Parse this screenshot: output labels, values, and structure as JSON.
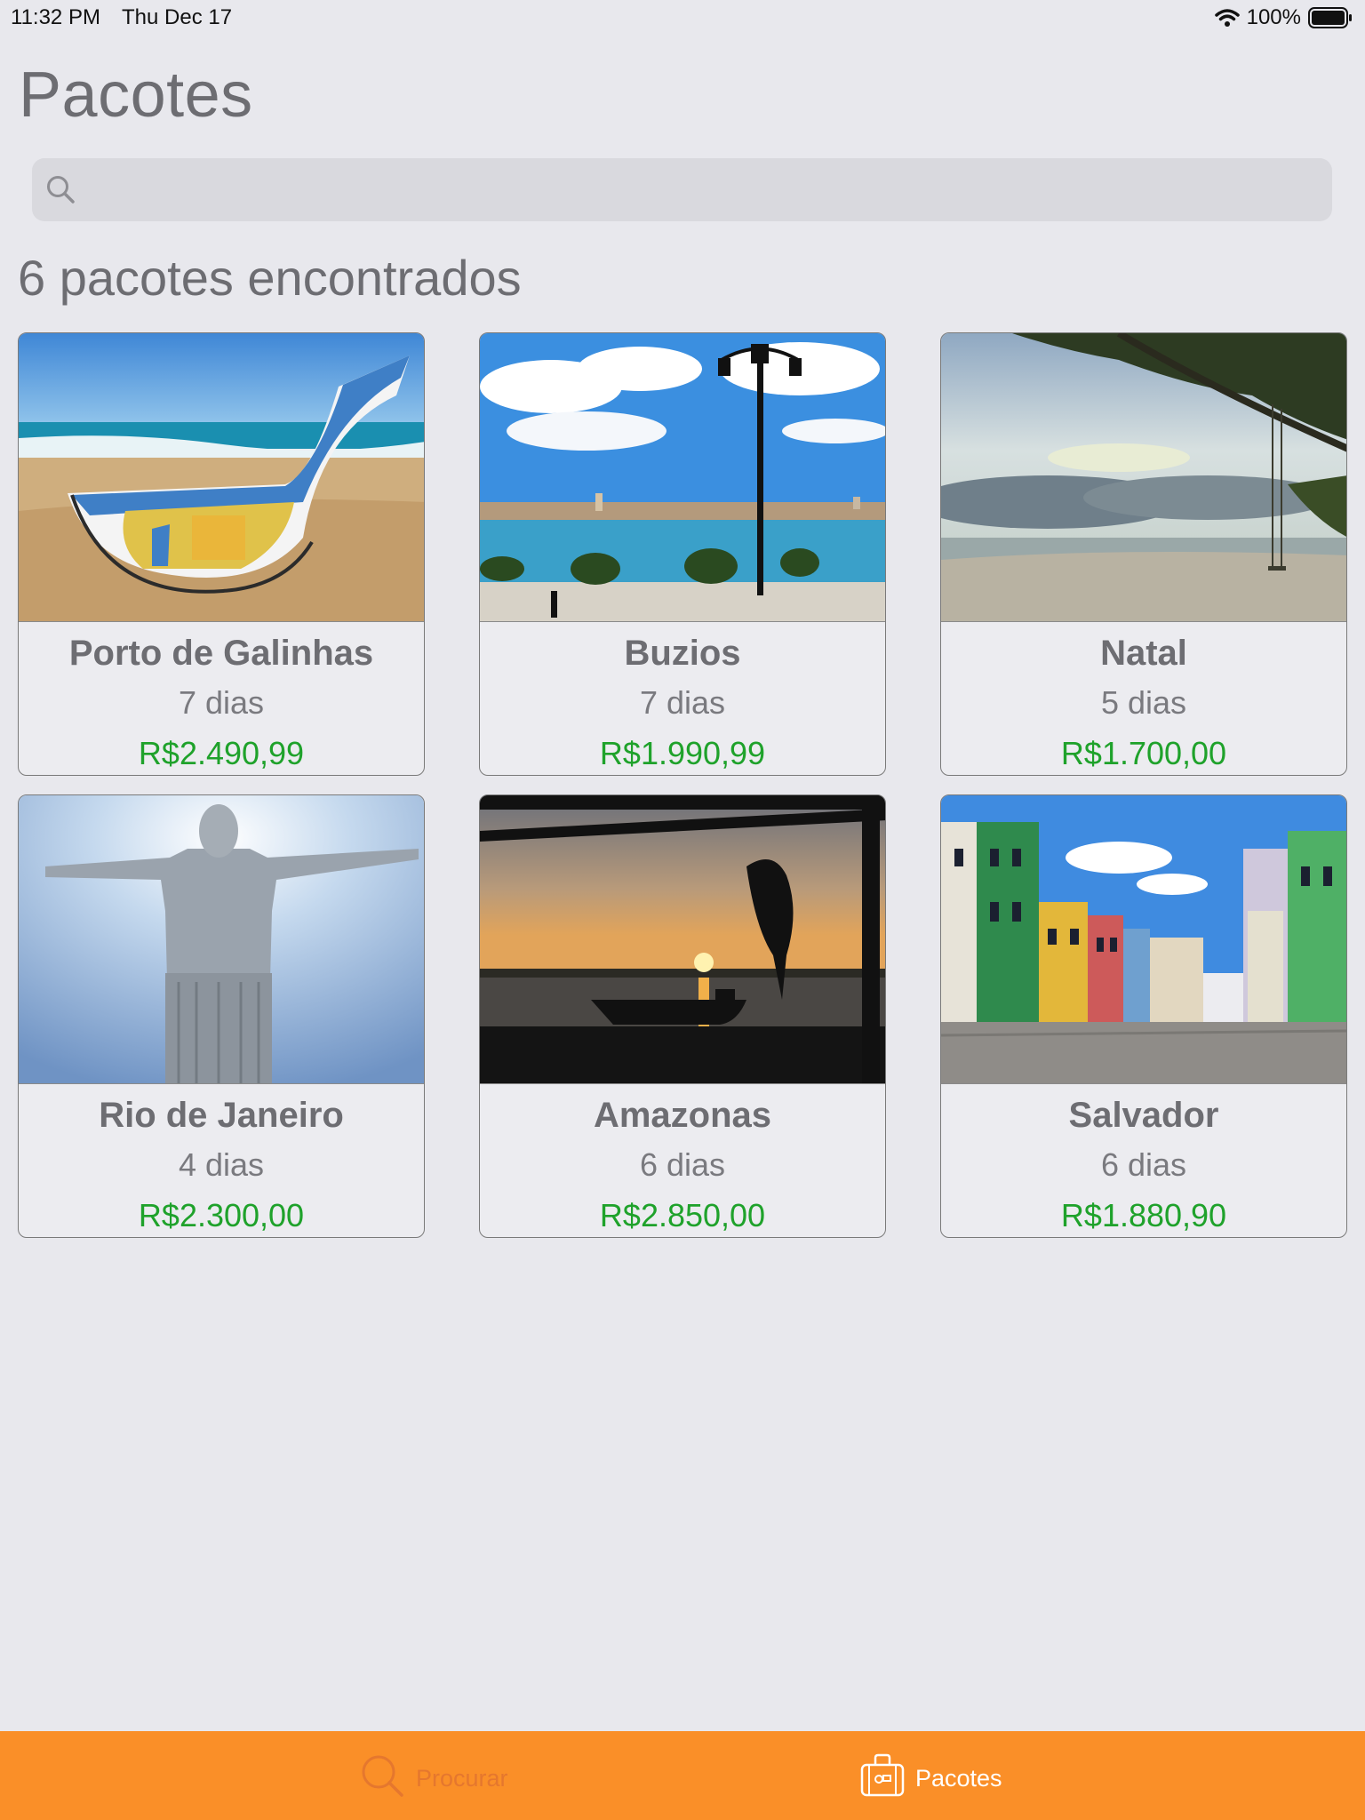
{
  "status_bar": {
    "time": "11:32 PM",
    "date": "Thu Dec 17",
    "battery": "100%"
  },
  "title": "Pacotes",
  "search": {
    "placeholder": "",
    "value": ""
  },
  "results_label": "6 pacotes encontrados",
  "packages": [
    {
      "name": "Porto de Galinhas",
      "duration": "7 dias",
      "price": "R$2.490,99",
      "image": "beach-boat"
    },
    {
      "name": "Buzios",
      "duration": "7 dias",
      "price": "R$1.990,99",
      "image": "waterfront-lamp"
    },
    {
      "name": "Natal",
      "duration": "5 dias",
      "price": "R$1.700,00",
      "image": "beach-tree-swing"
    },
    {
      "name": "Rio de Janeiro",
      "duration": "4 dias",
      "price": "R$2.300,00",
      "image": "christ-statue"
    },
    {
      "name": "Amazonas",
      "duration": "6 dias",
      "price": "R$2.850,00",
      "image": "river-sunset"
    },
    {
      "name": "Salvador",
      "duration": "6 dias",
      "price": "R$1.880,90",
      "image": "colonial-street"
    }
  ],
  "tabs": [
    {
      "label": "Procurar",
      "icon": "search-icon",
      "selected": false
    },
    {
      "label": "Pacotes",
      "icon": "suitcase-icon",
      "selected": true
    }
  ],
  "colors": {
    "accent": "#fa8f28",
    "price": "#1fa22b",
    "background": "#e8e8ed"
  }
}
